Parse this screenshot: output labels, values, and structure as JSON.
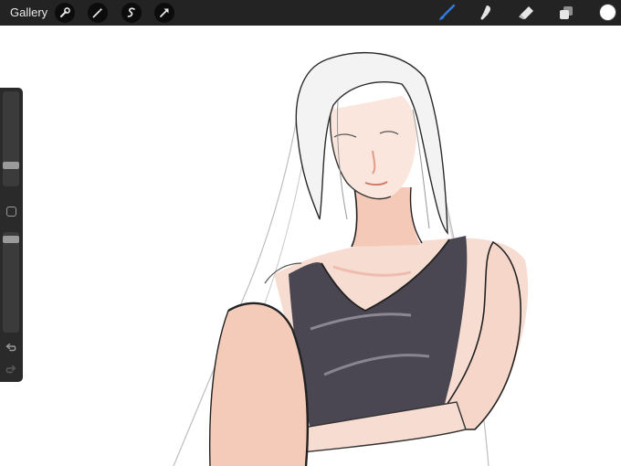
{
  "toolbar": {
    "gallery_label": "Gallery",
    "left_tools": [
      "wrench-icon",
      "magic-wand-icon",
      "selection-icon",
      "transform-arrow-icon"
    ],
    "right_tools": [
      "brush-icon",
      "smudge-icon",
      "eraser-icon",
      "layers-icon"
    ],
    "active_tool": "brush",
    "accent_color": "#2f7be6",
    "current_color": "#ffffff"
  },
  "sidebar": {
    "brush_size": 0.2,
    "opacity": 0.96,
    "undo_icon": "undo-icon",
    "redo_icon": "redo-icon"
  }
}
